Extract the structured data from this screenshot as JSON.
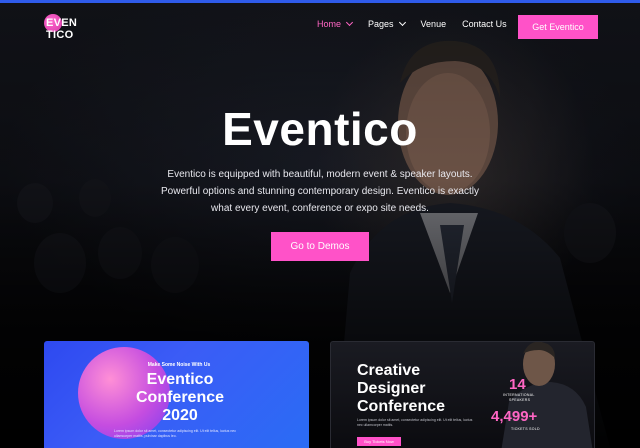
{
  "brand": {
    "logo_line1": "EVEN",
    "logo_line2": "TICO"
  },
  "nav": {
    "items": [
      {
        "label": "Home",
        "active": true,
        "has_dropdown": true
      },
      {
        "label": "Pages",
        "active": false,
        "has_dropdown": true
      },
      {
        "label": "Venue",
        "active": false,
        "has_dropdown": false
      },
      {
        "label": "Contact Us",
        "active": false,
        "has_dropdown": false
      }
    ],
    "cta_label": "Get Eventico"
  },
  "hero": {
    "title": "Eventico",
    "description": "Eventico is equipped with beautiful, modern event & speaker layouts. Powerful options and stunning contemporary design. Eventico is exactly what every event, conference or expo site needs.",
    "button_label": "Go to Demos"
  },
  "cards": {
    "left": {
      "kicker": "Make Some Noise With Us",
      "title_line1": "Eventico",
      "title_line2": "Conference",
      "title_line3": "2020",
      "text": "Lorem ipsum dolor sit amet, consectetur adipiscing elit. Ut elit tellus, luctus nec ullamcorper mattis, pulvinar dapibus leo."
    },
    "right": {
      "title_line1": "Creative",
      "title_line2": "Designer",
      "title_line3": "Conference",
      "text": "Lorem ipsum dolor sit amet, consectetur adipiscing elit. Ut elit tellus, luctus nec ullamcorper mattis.",
      "button_label": "Buy Tickets Now",
      "stat1_value": "14",
      "stat1_label1": "INTERNATIONAL",
      "stat1_label2": "SPEAKERS",
      "stat2_value": "4,499+",
      "stat2_label": "TICKETS SOLD"
    }
  },
  "colors": {
    "accent": "#ff52c8",
    "top_bar": "#2f5bea",
    "nav_active": "#ff66c4"
  }
}
